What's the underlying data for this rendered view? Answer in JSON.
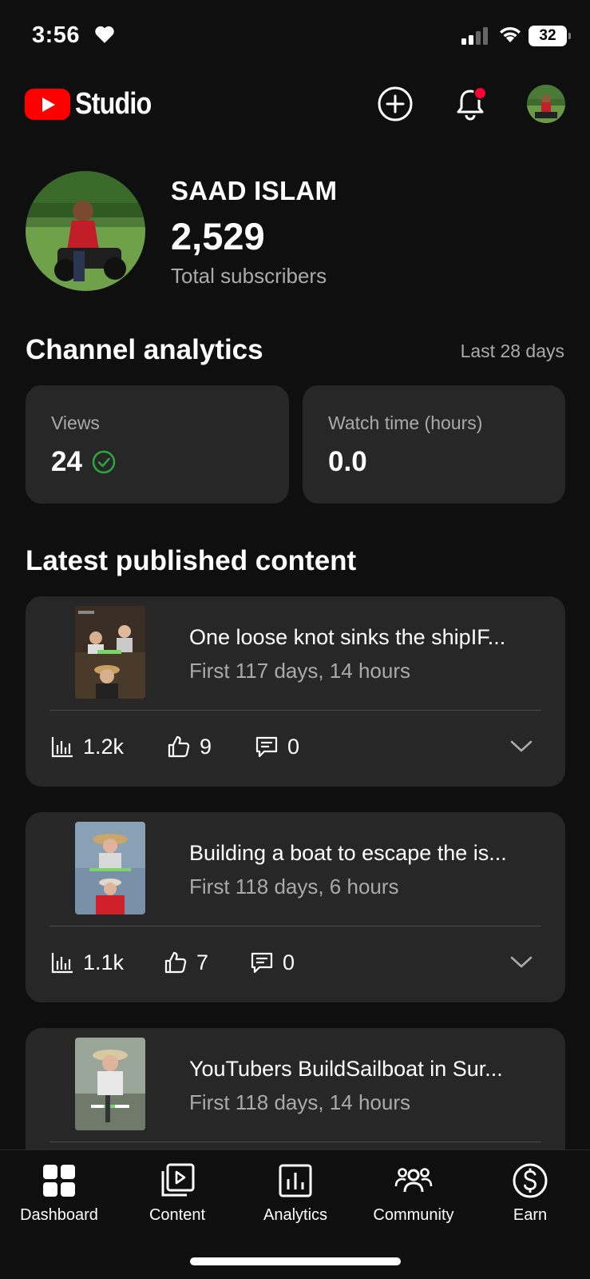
{
  "status_bar": {
    "time": "3:56",
    "battery": "32",
    "icons": [
      "heart-icon",
      "cellular-signal-icon",
      "wifi-icon",
      "battery-icon"
    ]
  },
  "header": {
    "logo_text": "Studio",
    "icons": [
      "youtube-logo-icon",
      "create-icon",
      "notifications-icon"
    ]
  },
  "channel": {
    "name": "SAAD ISLAM",
    "subscriber_count": "2,529",
    "subscriber_label": "Total subscribers"
  },
  "analytics": {
    "title": "Channel analytics",
    "period": "Last 28 days",
    "metrics": [
      {
        "label": "Views",
        "value": "24"
      },
      {
        "label": "Watch time (hours)",
        "value": "0.0"
      }
    ]
  },
  "latest": {
    "title": "Latest published content",
    "items": [
      {
        "title": "One loose knot sinks the shipIF...",
        "subtitle": "First 117 days, 14 hours",
        "views": "1.2k",
        "likes": "9",
        "comments": "0"
      },
      {
        "title": "Building a boat to escape the is...",
        "subtitle": "First 118 days, 6 hours",
        "views": "1.1k",
        "likes": "7",
        "comments": "0"
      },
      {
        "title": "YouTubers BuildSailboat in Sur...",
        "subtitle": "First 118 days, 14 hours",
        "views": "",
        "likes": "",
        "comments": ""
      }
    ]
  },
  "bottom_nav": {
    "items": [
      {
        "label": "Dashboard",
        "icon": "dashboard-icon"
      },
      {
        "label": "Content",
        "icon": "content-icon"
      },
      {
        "label": "Analytics",
        "icon": "analytics-icon"
      },
      {
        "label": "Community",
        "icon": "community-icon"
      },
      {
        "label": "Earn",
        "icon": "earn-icon"
      }
    ]
  },
  "colors": {
    "background": "#0f0f0f",
    "card": "#272727",
    "secondary_text": "#aaaaaa",
    "brand_red": "#ff0000",
    "check_green": "#2ba640"
  }
}
